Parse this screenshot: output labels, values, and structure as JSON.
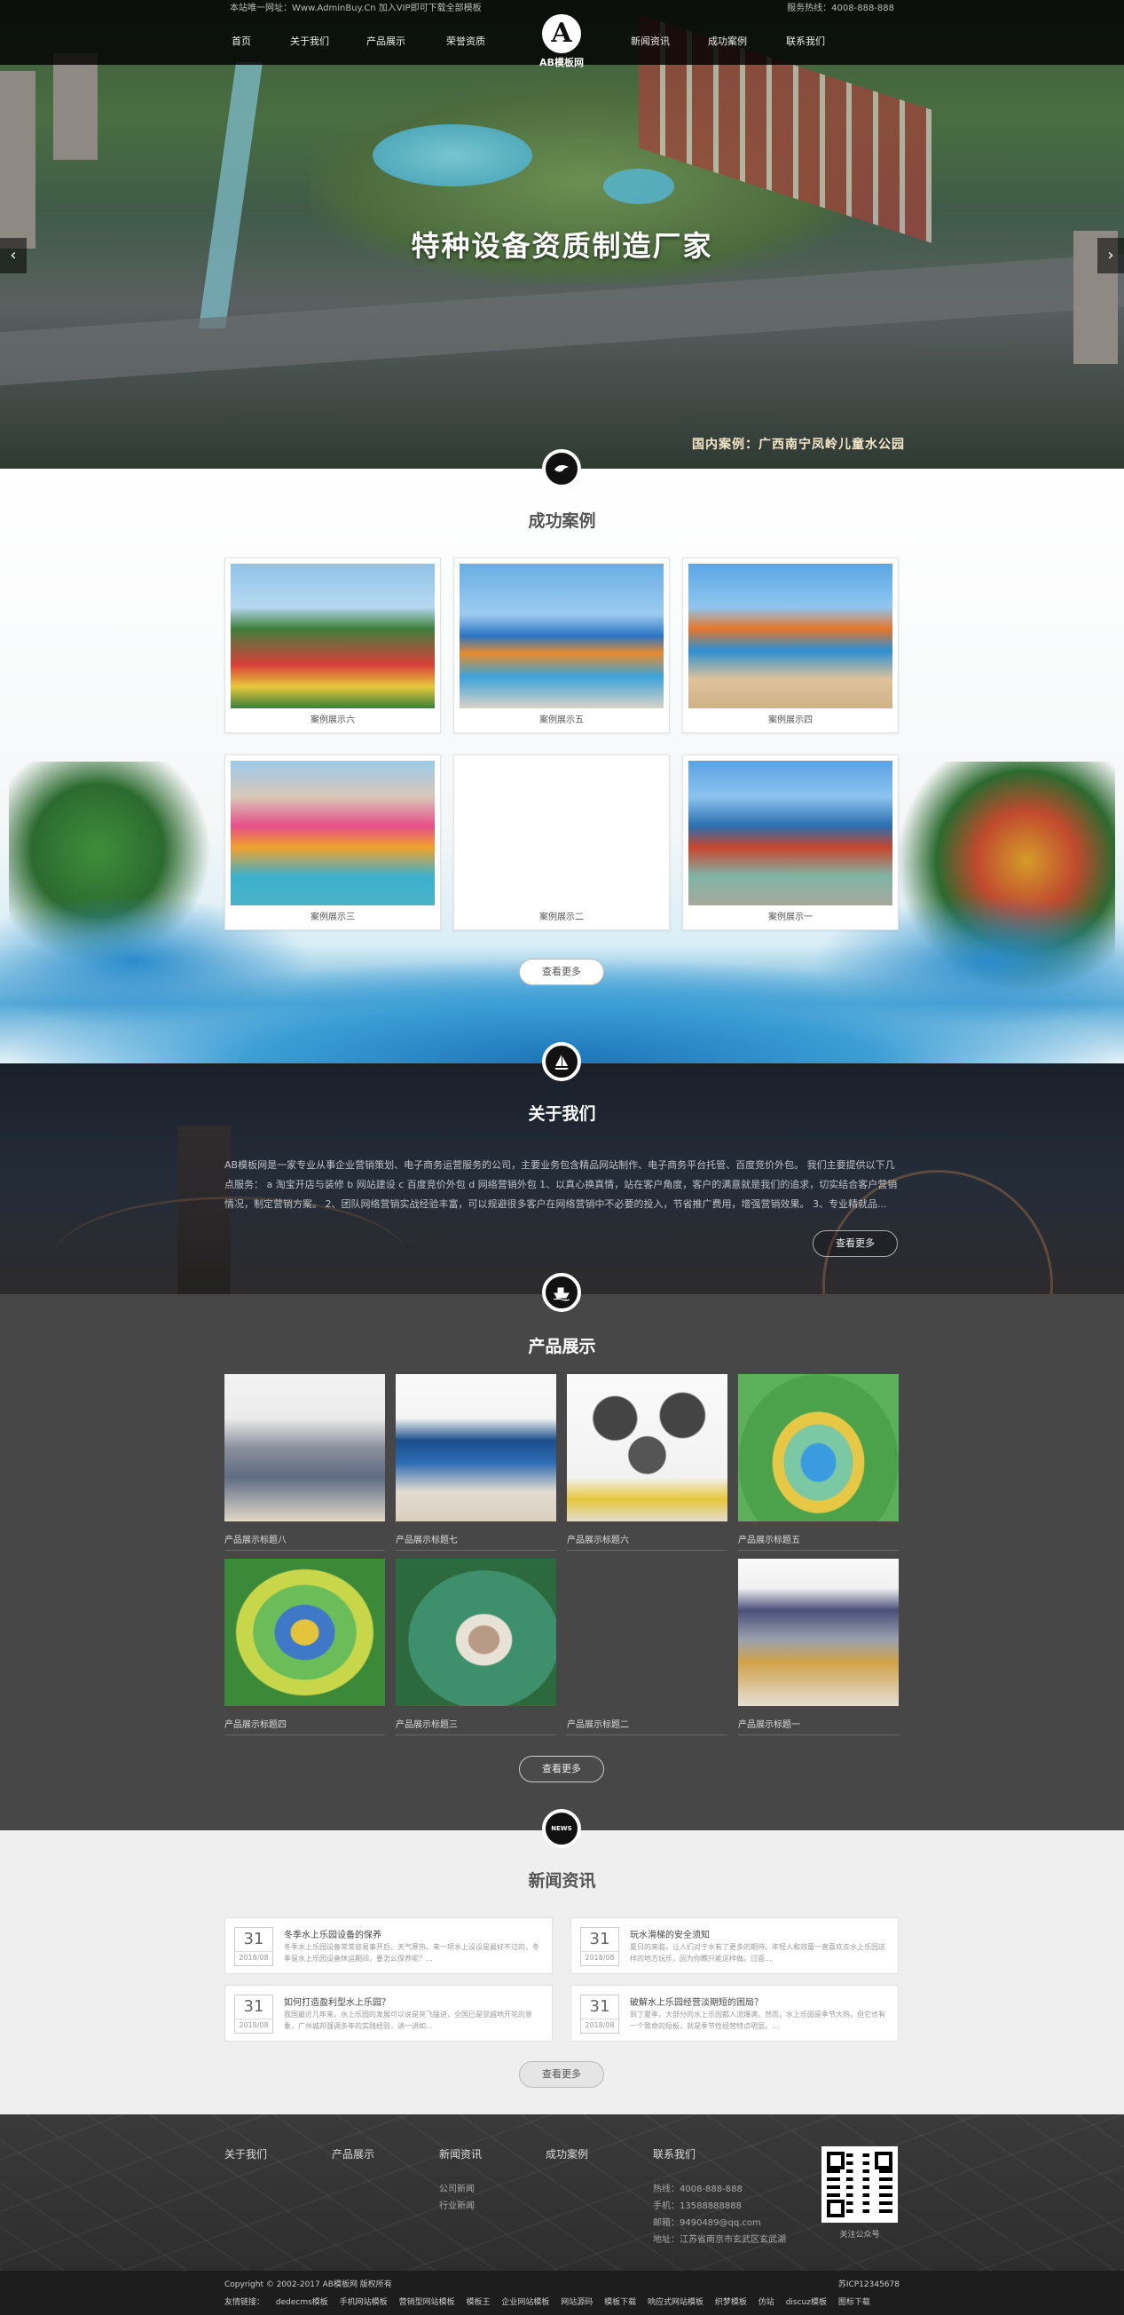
{
  "header": {
    "site_notice": "本站唯一网址：Www.AdminBuy.Cn 加入VIP即可下载全部模板",
    "hotline": "服务热线：4008-888-888",
    "logo_letter": "A",
    "logo_text": "AB模板网",
    "nav": [
      "首页",
      "关于我们",
      "产品展示",
      "荣誉资质",
      "新闻资讯",
      "成功案例",
      "联系我们"
    ]
  },
  "banner": {
    "title": "特种设备资质制造厂家",
    "caption": "国内案例：广西南宁凤岭儿童水公园",
    "prev": "‹",
    "next": "›"
  },
  "cases": {
    "title": "成功案例",
    "icon": "bird-icon",
    "items": [
      "案例展示六",
      "案例展示五",
      "案例展示四",
      "案例展示三",
      "案例展示二",
      "案例展示一"
    ],
    "more": "查看更多"
  },
  "about": {
    "title": "关于我们",
    "icon": "sailboat-icon",
    "text": "AB模板网是一家专业从事企业营销策划、电子商务运营服务的公司，主要业务包含精品网站制作、电子商务平台托管、百度竞价外包。 我们主要提供以下几点服务： a 淘宝开店与装修 b 网站建设 c 百度竞价外包 d 网络营销外包 1、以真心换真情，站在客户角度，客户的满意就是我们的追求，切实结合客户营销情况，制定营销方案。 2、团队网络营销实战经验丰富，可以规避很多客户在网络营销中不必要的投入，节省推广费用，增强营销效果。 3、专业精就品...",
    "more": "查看更多"
  },
  "products": {
    "title": "产品展示",
    "icon": "ship-icon",
    "items": [
      "产品展示标题八",
      "产品展示标题七",
      "产品展示标题六",
      "产品展示标题五",
      "产品展示标题四",
      "产品展示标题三",
      "产品展示标题二",
      "产品展示标题一"
    ],
    "more": "查看更多"
  },
  "news": {
    "title": "新闻资讯",
    "icon_text": "NEWS",
    "items": [
      {
        "day": "31",
        "ym": "2018/08",
        "title": "冬季水上乐园设备的保养",
        "summary": "冬季水上乐园设备常常容易事开后、天气寒热、来一项水上设设是最好不过的，冬季是水上乐园设备休运期间，要怎么保养呢？..."
      },
      {
        "day": "31",
        "ym": "2018/08",
        "title": "玩水滑梯的安全须知",
        "summary": "夏日的来临，让人们对于水有了更多的期待。年轻人和效童一直喜欢去水上乐园这样的地方玩乐，因为你瞧只能这样做。过面..."
      },
      {
        "day": "31",
        "ym": "2018/08",
        "title": "如何打造盈利型水上乐园？",
        "summary": "我国最近几年来，水上乐园的发展可以说是突飞猛进，全国已是觉越地开花的景象，广州城邦强调多年的实践经验，讲一讲如..."
      },
      {
        "day": "31",
        "ym": "2018/08",
        "title": "破解水上乐园经营淡期短的困局？",
        "summary": "到了夏季，大部分的水上乐园都人流爆满，然而，水上乐园是季节大热，但它也有一个致命的短板，就是季节性经营特点明显。..."
      }
    ],
    "more": "查看更多"
  },
  "footer": {
    "cols": [
      {
        "title": "关于我们",
        "links": []
      },
      {
        "title": "产品展示",
        "links": []
      },
      {
        "title": "新闻资讯",
        "links": [
          "公司新闻",
          "行业新闻"
        ]
      },
      {
        "title": "成功案例",
        "links": []
      },
      {
        "title": "联系我们",
        "links": [
          "热线：4008-888-888",
          "手机：13588888888",
          "邮箱：9490489@qq.com",
          "地址：江苏省南京市玄武区玄武湖"
        ]
      }
    ],
    "qr_caption": "关注公众号",
    "copyright": "Copyright © 2002-2017 AB模板网 版权所有",
    "icp": "苏ICP12345678",
    "friend_links": [
      "友情链接：",
      "dedecms模板",
      "手机网站模板",
      "营销型网站模板",
      "模板王",
      "企业网站模板",
      "网站源码",
      "模板下载",
      "响应式网站模板",
      "织梦模板",
      "仿站",
      "discuz模板",
      "图标下载"
    ]
  }
}
